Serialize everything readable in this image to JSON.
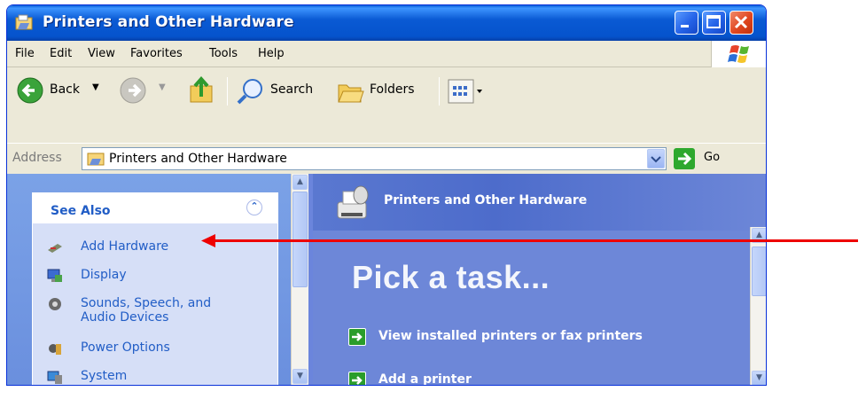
{
  "window": {
    "title": "Printers and Other Hardware"
  },
  "menu": [
    "File",
    "Edit",
    "View",
    "Favorites",
    "Tools",
    "Help"
  ],
  "toolbar": {
    "back_label": "Back",
    "search_label": "Search",
    "folders_label": "Folders"
  },
  "address": {
    "label": "Address",
    "value": "Printers and Other Hardware",
    "go_label": "Go"
  },
  "see_also": {
    "title": "See Also",
    "items": [
      {
        "label": "Add Hardware",
        "icon": "hardware-icon"
      },
      {
        "label": "Display",
        "icon": "display-icon"
      },
      {
        "label": "Sounds, Speech, and",
        "label2": "Audio Devices",
        "icon": "speaker-icon"
      },
      {
        "label": "Power Options",
        "icon": "power-icon"
      },
      {
        "label": "System",
        "icon": "system-icon"
      }
    ]
  },
  "main": {
    "header": "Printers and Other Hardware",
    "pick_task": "Pick a task...",
    "tasks": [
      "View installed printers or fax printers",
      "Add a printer"
    ]
  },
  "colors": {
    "title_bar": "#0a5ad4",
    "link": "#215dc6",
    "task_pane": "#6d87d8",
    "annotation_arrow": "#ee0000"
  }
}
